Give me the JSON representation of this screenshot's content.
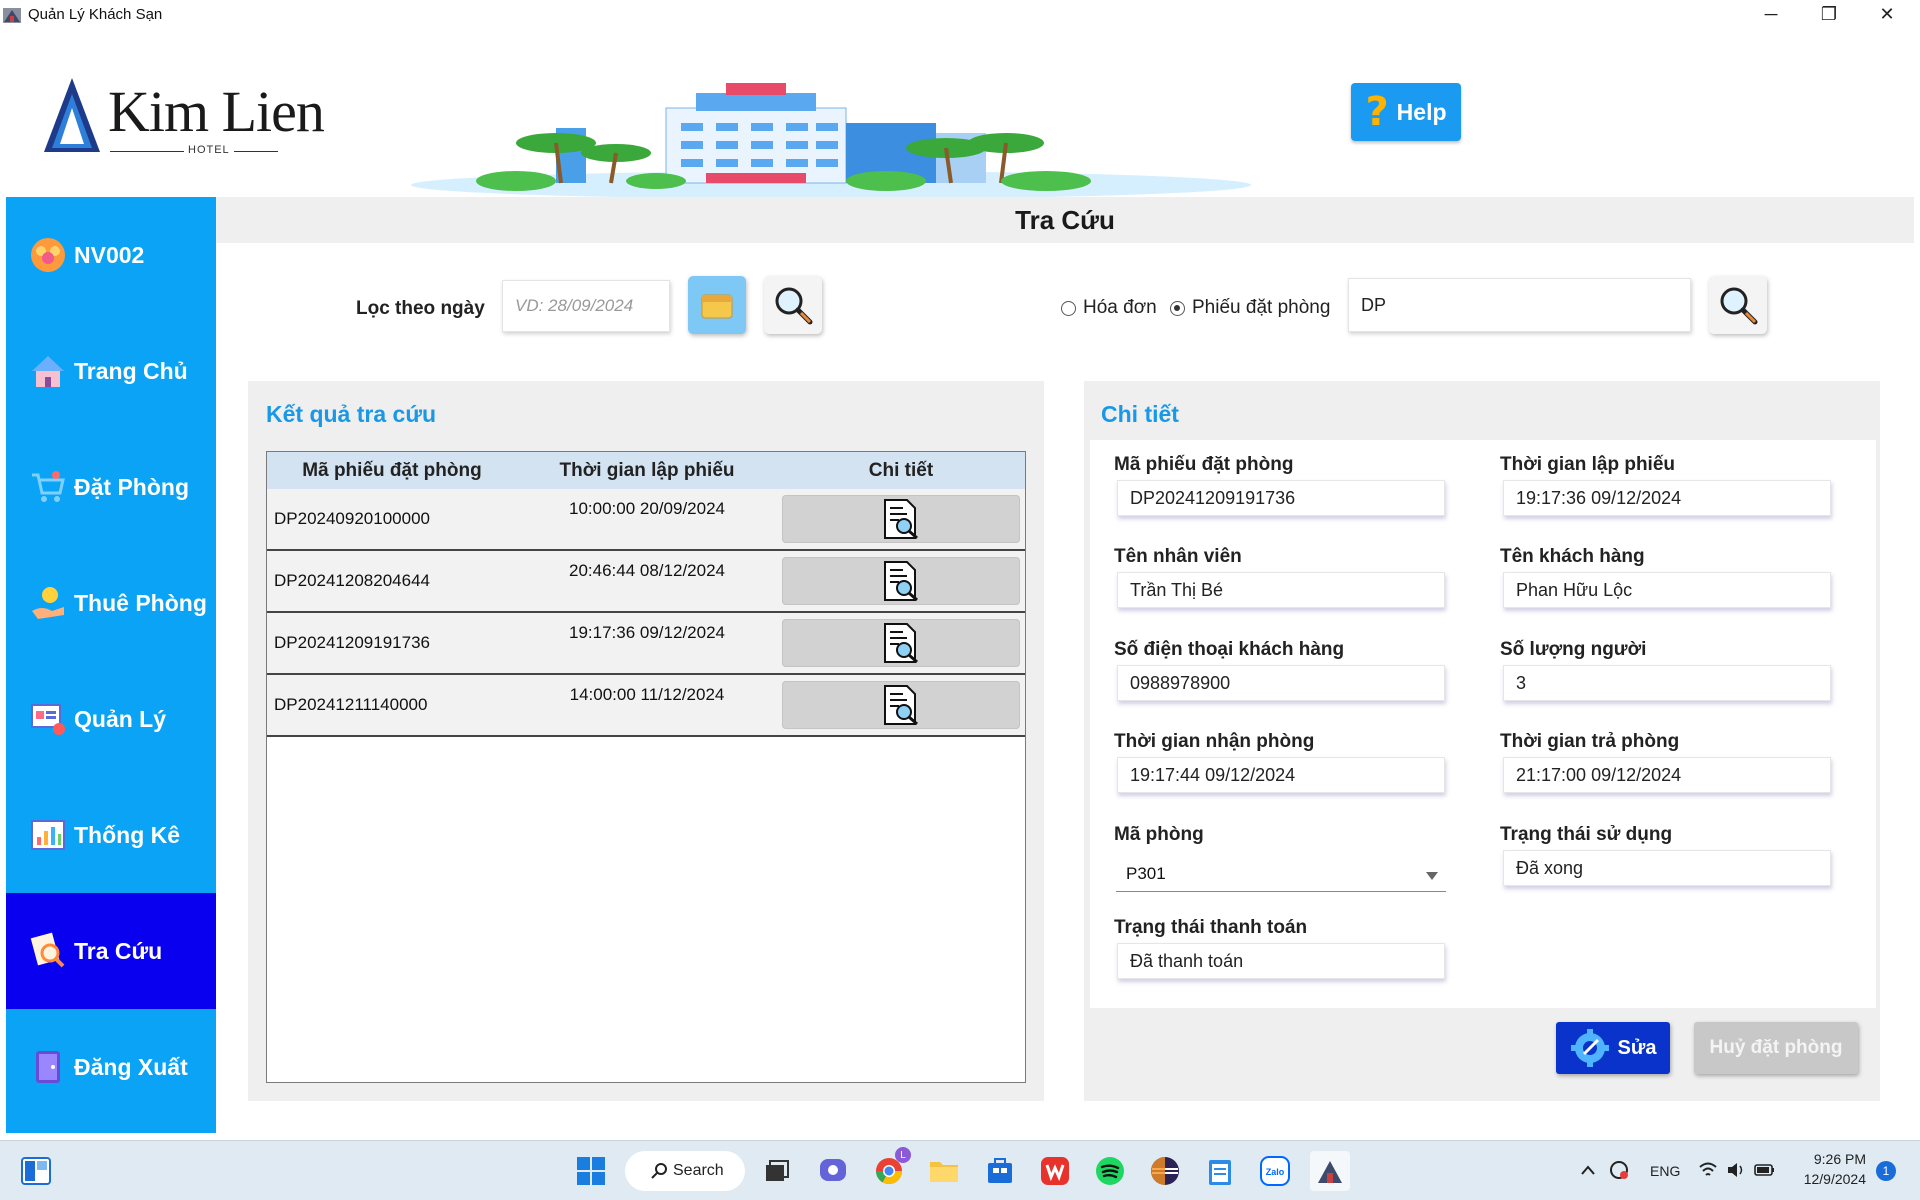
{
  "window": {
    "title": "Quản Lý Khách Sạn",
    "controls": {
      "minimize": "─",
      "restore": "❐",
      "close": "✕"
    }
  },
  "header": {
    "logo_name": "Kim Lien",
    "logo_sub": "HOTEL",
    "help_label": "Help",
    "help_glyph": "?"
  },
  "sidebar": {
    "items": [
      {
        "label": "NV002",
        "icon": "user-group-icon",
        "active": false
      },
      {
        "label": "Trang Chủ",
        "icon": "home-icon",
        "active": false
      },
      {
        "label": "Đặt Phòng",
        "icon": "cart-icon",
        "active": false
      },
      {
        "label": "Thuê Phòng",
        "icon": "hand-coin-icon",
        "active": false
      },
      {
        "label": "Quản Lý",
        "icon": "dashboard-icon",
        "active": false
      },
      {
        "label": "Thống Kê",
        "icon": "chart-icon",
        "active": false
      },
      {
        "label": "Tra Cứu",
        "icon": "search-doc-icon",
        "active": true
      },
      {
        "label": "Đăng Xuất",
        "icon": "logout-icon",
        "active": false
      }
    ]
  },
  "page": {
    "title": "Tra Cứu"
  },
  "filter": {
    "date_label": "Lọc theo ngày",
    "date_placeholder": "VD: 28/09/2024",
    "radio_invoice": "Hóa đơn",
    "radio_booking": "Phiếu đặt phòng",
    "selected_radio": "Phiếu đặt phòng",
    "search_value": "DP"
  },
  "results": {
    "title": "Kết quả tra cứu",
    "columns": [
      "Mã phiếu đặt phòng",
      "Thời gian lập phiếu",
      "Chi tiết"
    ],
    "rows": [
      {
        "code": "DP20240920100000",
        "time": "10:00:00 20/09/2024"
      },
      {
        "code": "DP20241208204644",
        "time": "20:46:44 08/12/2024"
      },
      {
        "code": "DP20241209191736",
        "time": "19:17:36 09/12/2024"
      },
      {
        "code": "DP20241211140000",
        "time": "14:00:00 11/12/2024"
      }
    ]
  },
  "detail": {
    "title": "Chi tiết",
    "booking_code_label": "Mã phiếu đặt phòng",
    "booking_code": "DP20241209191736",
    "created_time_label": "Thời gian lập phiếu",
    "created_time": "19:17:36 09/12/2024",
    "staff_label": "Tên nhân viên",
    "staff": "Trần Thị Bé",
    "customer_label": "Tên khách hàng",
    "customer": "Phan Hữu Lộc",
    "phone_label": "Số điện thoại khách hàng",
    "phone": "0988978900",
    "people_label": "Số lượng người",
    "people": "3",
    "checkin_label": "Thời gian nhận phòng",
    "checkin": "19:17:44 09/12/2024",
    "checkout_label": "Thời gian trả phòng",
    "checkout": "21:17:00 09/12/2024",
    "room_label": "Mã phòng",
    "room": "P301",
    "usage_label": "Trạng thái sử dụng",
    "usage": "Đã xong",
    "payment_label": "Trạng thái thanh toán",
    "payment": "Đã thanh toán",
    "edit_label": "Sửa",
    "cancel_label": "Huỷ đặt phòng"
  },
  "taskbar": {
    "search_label": "Search",
    "language": "ENG",
    "time": "9:26 PM",
    "date": "12/9/2024",
    "notification_count": "1",
    "chrome_badge": "L"
  },
  "colors": {
    "sidebar": "#0aa3f5",
    "sidebar_active": "#0a00f0",
    "accent_title": "#1a98e8",
    "edit_button": "#0a33cc",
    "help_button": "#1a9af0"
  }
}
